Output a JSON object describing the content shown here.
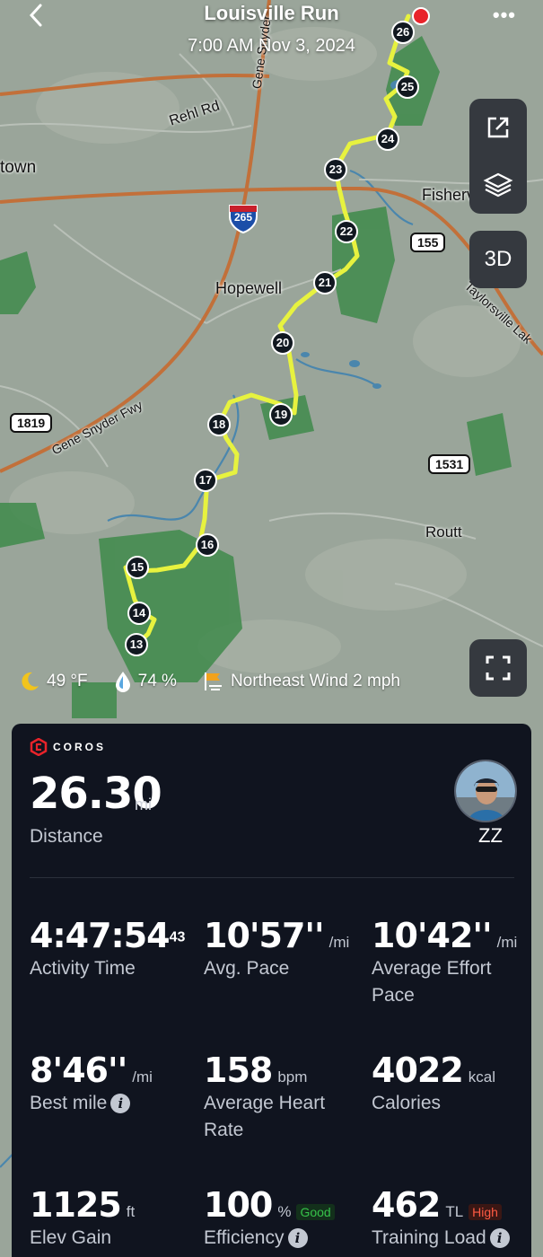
{
  "header": {
    "title": "Louisville Run",
    "datetime": "7:00 AM Nov 3, 2024",
    "back_label": "<",
    "more_label": "•••"
  },
  "map": {
    "labels": {
      "rehl_rd": "Rehl Rd",
      "town": "town",
      "fisherville": "Fisherville",
      "hopewell": "Hopewell",
      "gene_snyder_fwy": "Gene Snyder Fwy",
      "gene_snyder_top": "Gene Snyder",
      "taylorsville": "Taylorsville Lak",
      "routt": "Routt"
    },
    "shields": {
      "i265": "265",
      "r155": "155",
      "r1819": "1819",
      "r1531": "1531"
    },
    "mile_markers": [
      "13",
      "14",
      "15",
      "16",
      "17",
      "18",
      "19",
      "20",
      "21",
      "22",
      "23",
      "24",
      "25",
      "26"
    ],
    "buttons": {
      "threed_label": "3D"
    },
    "colors": {
      "route": "#e7f23f",
      "road": "#c2703a",
      "water": "#4a86ad",
      "park": "#3f8a4b",
      "land": "#9aa59a"
    }
  },
  "weather": {
    "temp": "49 °F",
    "humidity": "74  %",
    "wind": "Northeast Wind 2 mph"
  },
  "summary": {
    "brand": "COROS",
    "distance_value": "26.30",
    "distance_unit": "mi",
    "distance_label": "Distance",
    "user_name": "ZZ",
    "stats": {
      "activity_time": {
        "value": "4:47:54",
        "sup": "43",
        "label": "Activity Time"
      },
      "avg_pace": {
        "value": "10'57''",
        "unit": "/mi",
        "label": "Avg. Pace"
      },
      "avg_effort_pace": {
        "value": "10'42''",
        "unit": "/mi",
        "label": "Average Effort Pace"
      },
      "best_mile": {
        "value": "8'46''",
        "unit": "/mi",
        "label": "Best mile"
      },
      "avg_hr": {
        "value": "158",
        "unit": "bpm",
        "label": "Average Heart Rate"
      },
      "calories": {
        "value": "4022",
        "unit": "kcal",
        "label": "Calories"
      },
      "elev_gain": {
        "value": "1125",
        "unit": "ft",
        "label": "Elev Gain"
      },
      "efficiency": {
        "value": "100",
        "unit": "%",
        "tag": "Good",
        "label": "Efficiency"
      },
      "training_load": {
        "value": "462",
        "unit": "TL",
        "tag": "High",
        "label": "Training Load"
      }
    },
    "info_icon_glyph": "i"
  }
}
